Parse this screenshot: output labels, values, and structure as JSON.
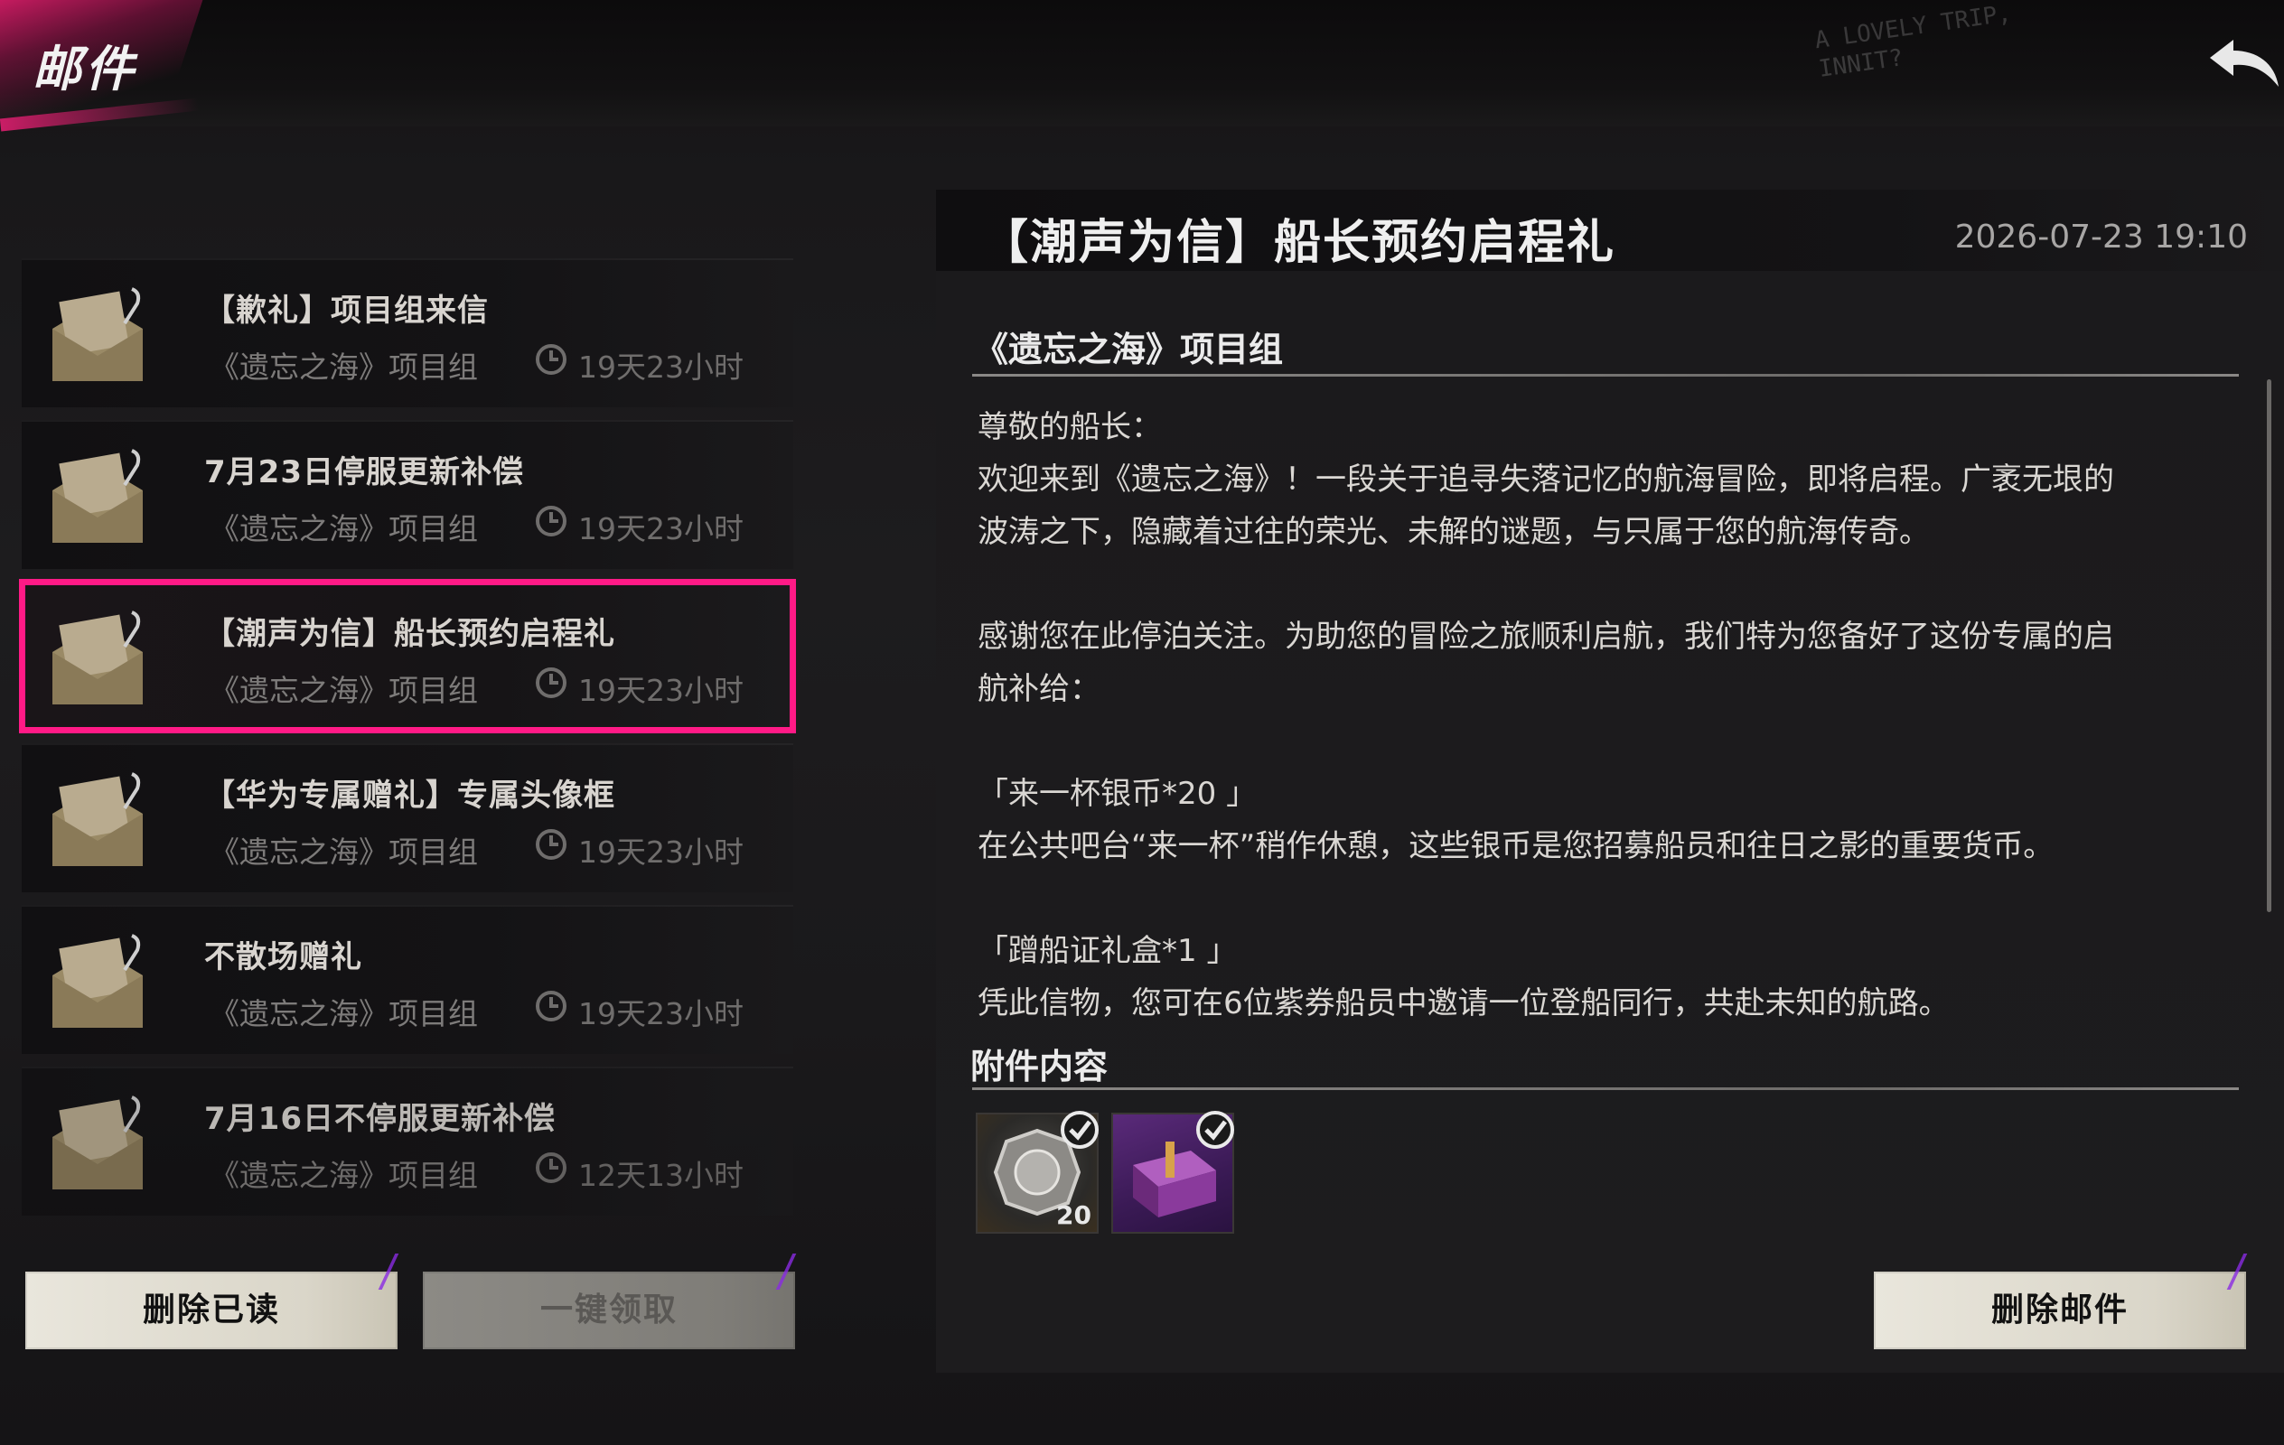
{
  "header": {
    "title": "邮件",
    "graffiti_line1": "A LOVELY TRIP,",
    "graffiti_line2": "INNIT?"
  },
  "mail_list": [
    {
      "title": "【歉礼】项目组来信",
      "sender": "《遗忘之海》项目组",
      "time": "19天23小时"
    },
    {
      "title": "7月23日停服更新补偿",
      "sender": "《遗忘之海》项目组",
      "time": "19天23小时"
    },
    {
      "title": "【潮声为信】船长预约启程礼",
      "sender": "《遗忘之海》项目组",
      "time": "19天23小时",
      "selected": true
    },
    {
      "title": "【华为专属赠礼】专属头像框",
      "sender": "《遗忘之海》项目组",
      "time": "19天23小时"
    },
    {
      "title": "不散场赠礼",
      "sender": "《遗忘之海》项目组",
      "time": "19天23小时"
    },
    {
      "title": "7月16日不停服更新补偿",
      "sender": "《遗忘之海》项目组",
      "time": "12天13小时"
    }
  ],
  "buttons": {
    "delete_read": "删除已读",
    "claim_all": "一键领取",
    "delete_mail": "删除邮件"
  },
  "detail": {
    "title": "【潮声为信】船长预约启程礼",
    "date": "2026-07-23 19:10",
    "sender": "《遗忘之海》项目组",
    "body": "尊敬的船长：\n欢迎来到《遗忘之海》！一段关于追寻失落记忆的航海冒险，即将启程。广袤无垠的\n波涛之下，隐藏着过往的荣光、未解的谜题，与只属于您的航海传奇。\n\n感谢您在此停泊关注。为助您的冒险之旅顺利启航，我们特为您备好了这份专属的启\n航补给：\n\n「来一杯银币*20 」\n在公共吧台“来一杯”稍作休憩，这些银币是您招募船员和往日之影的重要货币。\n\n「蹭船证礼盒*1 」\n凭此信物，您可在6位紫券船员中邀请一位登船同行，共赴未知的航路。",
    "attachments_heading": "附件内容",
    "attachments": [
      {
        "name": "来一杯银币",
        "quantity": "20",
        "icon": "silver-coin-icon"
      },
      {
        "name": "蹭船证礼盒",
        "quantity": "",
        "icon": "gift-box-icon"
      }
    ]
  },
  "colors": {
    "accent_pink": "#ff1a86",
    "button_bg": "#e9e6dc",
    "button_disabled_bg": "#8c8a85"
  }
}
